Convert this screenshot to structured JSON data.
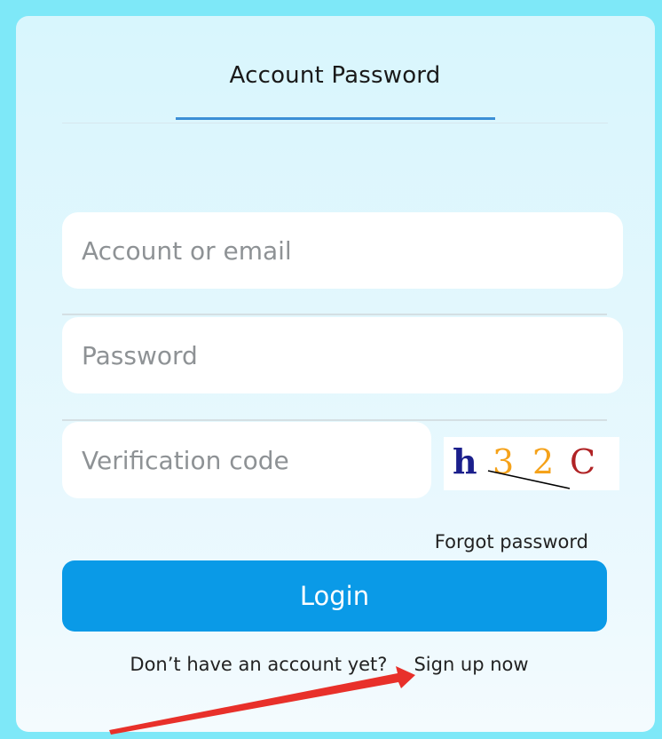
{
  "login_form": {
    "tab_label": "Account Password",
    "account_placeholder": "Account or email",
    "password_placeholder": "Password",
    "verification_placeholder": "Verification code",
    "captcha": {
      "chars": [
        "h",
        "3",
        "2",
        "C"
      ],
      "colors": [
        "#1b1f8c",
        "#f5a21a",
        "#f5a21a",
        "#b02325"
      ]
    },
    "forgot_label": "Forgot password",
    "login_label": "Login",
    "signup_prompt": "Don’t have an account yet?",
    "signup_link": "Sign up now"
  },
  "colors": {
    "accent": "#0a9ae7",
    "tab_underline": "#3c8fd6",
    "annotation_arrow": "#e8302a"
  }
}
